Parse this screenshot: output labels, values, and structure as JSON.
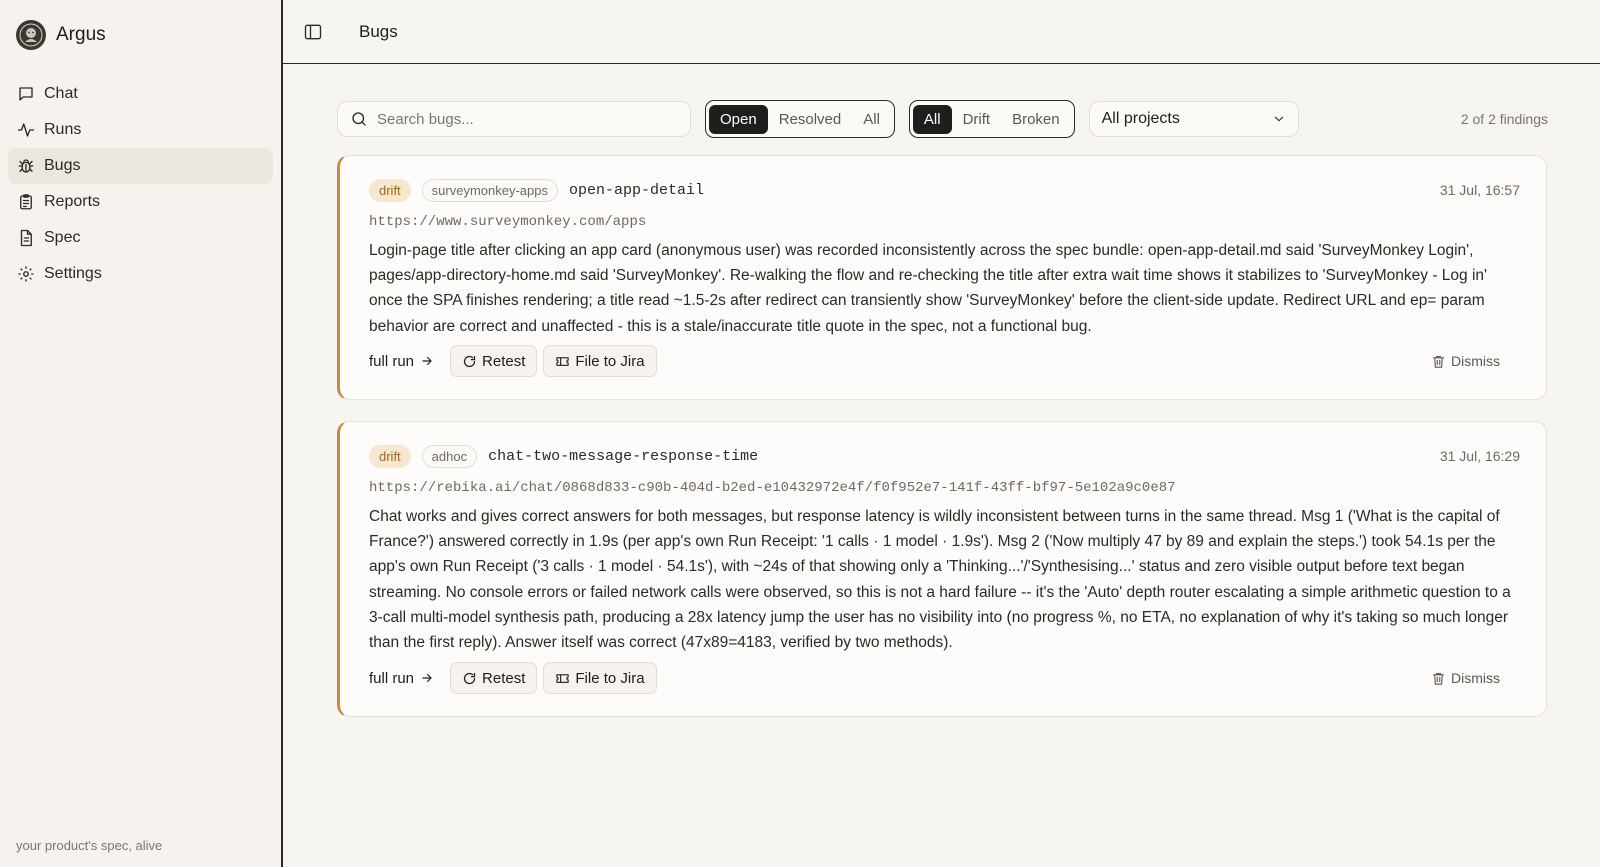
{
  "app": {
    "name": "Argus",
    "tagline": "your product's spec, alive"
  },
  "sidebar": {
    "items": [
      {
        "label": "Chat",
        "icon": "chat-bubble-icon"
      },
      {
        "label": "Runs",
        "icon": "activity-icon"
      },
      {
        "label": "Bugs",
        "icon": "bug-icon"
      },
      {
        "label": "Reports",
        "icon": "clipboard-icon"
      },
      {
        "label": "Spec",
        "icon": "document-icon"
      },
      {
        "label": "Settings",
        "icon": "gear-icon"
      }
    ],
    "active": "Bugs"
  },
  "header": {
    "title": "Bugs"
  },
  "filters": {
    "search_placeholder": "Search bugs...",
    "status_options": [
      "Open",
      "Resolved",
      "All"
    ],
    "status_selected": "Open",
    "type_options": [
      "All",
      "Drift",
      "Broken"
    ],
    "type_selected": "All",
    "project_selected": "All projects",
    "count_text": "2 of 2 findings"
  },
  "findings": [
    {
      "kind": "drift",
      "project": "surveymonkey-apps",
      "slug": "open-app-detail",
      "date": "31 Jul, 16:57",
      "url": "https://www.surveymonkey.com/apps",
      "description": "Login-page title after clicking an app card (anonymous user) was recorded inconsistently across the spec bundle: open-app-detail.md said 'SurveyMonkey Login', pages/app-directory-home.md said 'SurveyMonkey'. Re-walking the flow and re-checking the title after extra wait time shows it stabilizes to 'SurveyMonkey - Log in' once the SPA finishes rendering; a title read ~1.5-2s after redirect can transiently show 'SurveyMonkey' before the client-side update. Redirect URL and ep= param behavior are correct and unaffected - this is a stale/inaccurate title quote in the spec, not a functional bug.",
      "actions": {
        "full_run": "full run",
        "retest": "Retest",
        "jira": "File to Jira",
        "dismiss": "Dismiss"
      }
    },
    {
      "kind": "drift",
      "project": "adhoc",
      "slug": "chat-two-message-response-time",
      "date": "31 Jul, 16:29",
      "url": "https://rebika.ai/chat/0868d833-c90b-404d-b2ed-e10432972e4f/f0f952e7-141f-43ff-bf97-5e102a9c0e87",
      "description": "Chat works and gives correct answers for both messages, but response latency is wildly inconsistent between turns in the same thread. Msg 1 ('What is the capital of France?') answered correctly in 1.9s (per app's own Run Receipt: '1 calls · 1 model · 1.9s'). Msg 2 ('Now multiply 47 by 89 and explain the steps.') took 54.1s per the app's own Run Receipt ('3 calls · 1 model · 54.1s'), with ~24s of that showing only a 'Thinking...'/'Synthesising...' status and zero visible output before text began streaming. No console errors or failed network calls were observed, so this is not a hard failure -- it's the 'Auto' depth router escalating a simple arithmetic question to a 3-call multi-model synthesis path, producing a 28x latency jump the user has no visibility into (no progress %, no ETA, no explanation of why it's taking so much longer than the first reply). Answer itself was correct (47x89=4183, verified by two methods).",
      "actions": {
        "full_run": "full run",
        "retest": "Retest",
        "jira": "File to Jira",
        "dismiss": "Dismiss"
      }
    }
  ]
}
